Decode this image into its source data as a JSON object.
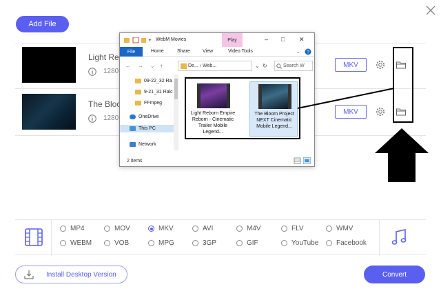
{
  "toolbar": {
    "add_file_label": "Add File"
  },
  "videos": [
    {
      "name": "Light Reb",
      "meta": "1280",
      "format": "MKV"
    },
    {
      "name": "The Bloo",
      "meta": "1280",
      "format": "MKV"
    }
  ],
  "explorer": {
    "title": "WebM Movies",
    "play_tab": "Play",
    "ribbon": {
      "file": "File",
      "home": "Home",
      "share": "Share",
      "view": "View",
      "video_tools": "Video Tools"
    },
    "address": "De... › Web...",
    "search_placeholder": "Search W",
    "sidebar": [
      "09-22_32 Ra",
      "9-21_31 Ralc",
      "FFmpeg",
      "OneDrive",
      "This PC",
      "Network"
    ],
    "files": [
      {
        "label": "Light Reborn Empire Reborn - Cinematic Trailer Mobile Legend..."
      },
      {
        "label": "The Bloom Project NEXT Cinematic Mobile Legend..."
      }
    ],
    "status": "2 items"
  },
  "formats": {
    "row1": [
      {
        "label": "MP4",
        "selected": false
      },
      {
        "label": "MOV",
        "selected": false
      },
      {
        "label": "MKV",
        "selected": true
      },
      {
        "label": "AVI",
        "selected": false
      },
      {
        "label": "M4V",
        "selected": false
      },
      {
        "label": "FLV",
        "selected": false
      },
      {
        "label": "WMV",
        "selected": false
      }
    ],
    "row2": [
      {
        "label": "WEBM",
        "selected": false
      },
      {
        "label": "VOB",
        "selected": false
      },
      {
        "label": "MPG",
        "selected": false
      },
      {
        "label": "3GP",
        "selected": false
      },
      {
        "label": "GIF",
        "selected": false
      },
      {
        "label": "YouTube",
        "selected": false
      },
      {
        "label": "Facebook",
        "selected": false
      }
    ]
  },
  "footer": {
    "install_label": "Install Desktop Version",
    "convert_label": "Convert"
  },
  "colors": {
    "accent": "#5b5ff0",
    "file_tab": "#1c66c5",
    "play_tab": "#f4c5e6"
  }
}
